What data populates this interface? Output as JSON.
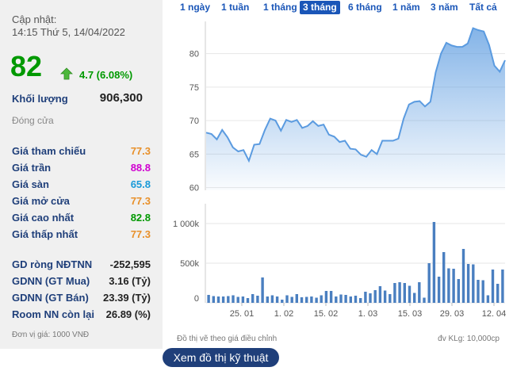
{
  "info": {
    "updated_label": "Cập nhật:",
    "updated_time": "14:15 Thứ 5, 14/04/2022",
    "price": "82",
    "change": "4.7 (6.08%)",
    "volume_label": "Khối lượng",
    "volume_value": "906,300",
    "close_label": "Đóng cửa",
    "unit": "Đơn vị giá: 1000 VNĐ"
  },
  "prices": [
    {
      "label": "Giá tham chiếu",
      "value": "77.3",
      "color": "#e8902a"
    },
    {
      "label": "Giá trần",
      "value": "88.8",
      "color": "#d000d0"
    },
    {
      "label": "Giá sàn",
      "value": "65.8",
      "color": "#1a9ad8"
    },
    {
      "label": "Giá mở cửa",
      "value": "77.3",
      "color": "#e8902a"
    },
    {
      "label": "Giá cao nhất",
      "value": "82.8",
      "color": "#009900"
    },
    {
      "label": "Giá thấp nhất",
      "value": "77.3",
      "color": "#e8902a"
    }
  ],
  "foreign": [
    {
      "label": "GD ròng NĐTNN",
      "value": "-252,595"
    },
    {
      "label": "GDNN (GT Mua)",
      "value": "3.16 (Tỷ)"
    },
    {
      "label": "GDNN (GT Bán)",
      "value": "23.39 (Tỷ)"
    },
    {
      "label": "Room NN còn lại",
      "value": "26.89 (%)"
    }
  ],
  "tabs": [
    "1 ngày",
    "1 tuần",
    "1 tháng",
    "3 tháng",
    "6 tháng",
    "1 năm",
    "3 năm",
    "Tất cả"
  ],
  "active_tab": "3 tháng",
  "footer": {
    "left": "Đồ thị vẽ theo giá điều chỉnh",
    "right": "đv KLg: 10,000cp",
    "button": "Xem đồ thị kỹ thuật"
  },
  "colors": {
    "up": "#009900",
    "accent": "#1a56b8",
    "line": "#5b9be0",
    "bar": "#4a7fc0"
  },
  "chart_data": [
    {
      "type": "area",
      "y_ticks": [
        60,
        65,
        70,
        75,
        80
      ],
      "ylim": [
        59.6,
        84.8
      ],
      "values": [
        68.2,
        68.0,
        67.2,
        68.6,
        67.5,
        66.0,
        65.4,
        65.6,
        64.0,
        66.4,
        66.5,
        68.6,
        70.3,
        70.0,
        68.5,
        70.1,
        69.8,
        70.1,
        68.9,
        69.2,
        69.9,
        69.2,
        69.4,
        67.9,
        67.6,
        66.8,
        67.0,
        65.8,
        65.7,
        64.9,
        64.6,
        65.6,
        65.0,
        67.0,
        67.0,
        67.0,
        67.3,
        70.3,
        72.4,
        72.8,
        72.9,
        72.1,
        72.8,
        77.2,
        80.0,
        81.6,
        81.2,
        81.0,
        81.0,
        81.5,
        83.8,
        83.5,
        83.3,
        81.3,
        78.2,
        77.3,
        79.0
      ]
    },
    {
      "type": "bar",
      "y_ticks_labels": [
        "0",
        "500k",
        "1 000k"
      ],
      "ylim": [
        0,
        1250000
      ],
      "x_tick_labels": [
        "25. 01",
        "1. 02",
        "15. 02",
        "1. 03",
        "15. 03",
        "29. 03",
        "12. 04"
      ],
      "values": [
        100000,
        85000,
        80000,
        80000,
        85000,
        95000,
        75000,
        80000,
        60000,
        110000,
        90000,
        320000,
        80000,
        95000,
        80000,
        40000,
        95000,
        75000,
        110000,
        70000,
        75000,
        80000,
        65000,
        95000,
        150000,
        150000,
        80000,
        105000,
        100000,
        80000,
        90000,
        60000,
        140000,
        120000,
        160000,
        210000,
        155000,
        110000,
        250000,
        260000,
        250000,
        215000,
        125000,
        260000,
        65000,
        500000,
        1020000,
        330000,
        640000,
        435000,
        430000,
        300000,
        680000,
        490000,
        485000,
        290000,
        285000,
        95000,
        420000,
        240000,
        420000
      ]
    }
  ]
}
